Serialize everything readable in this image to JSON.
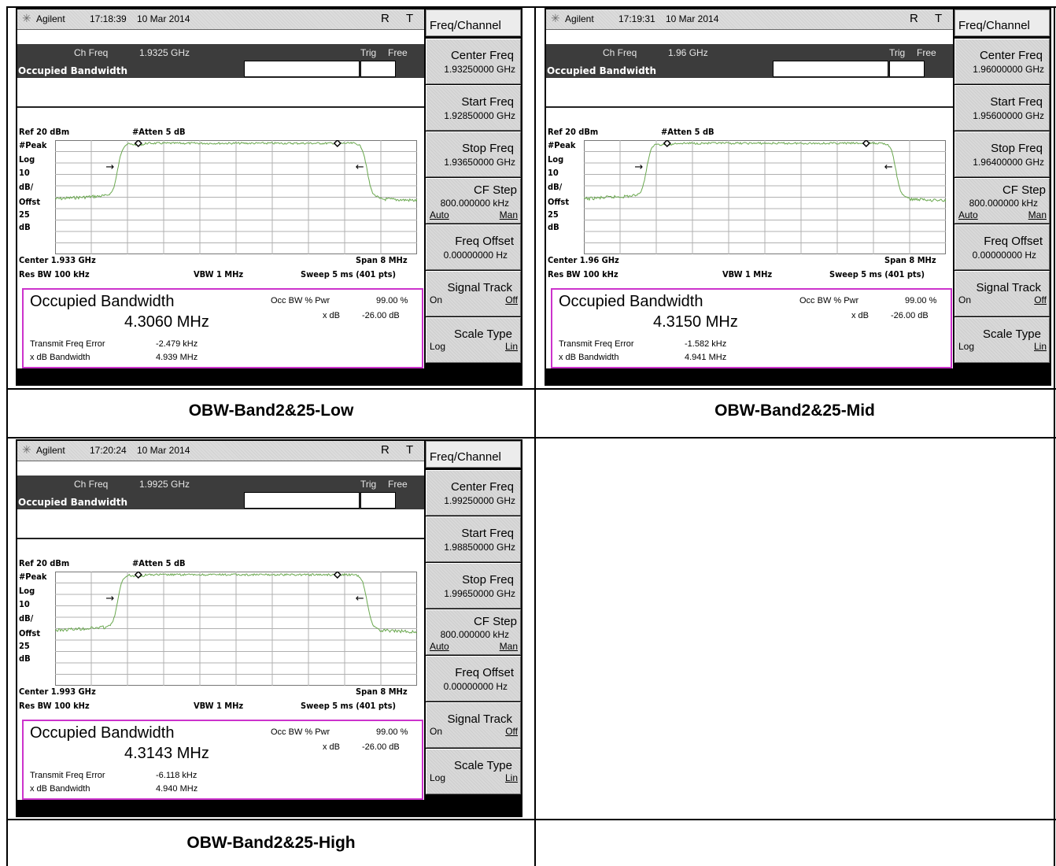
{
  "panels": [
    {
      "instrument": "Agilent",
      "time": "17:18:39",
      "date": "10 Mar 2014",
      "status_r": "R",
      "status_t": "T",
      "ch_freq_label": "Ch Freq",
      "ch_freq": "1.9325 GHz",
      "trig_label": "Trig",
      "trig_value": "Free",
      "meas_name": "Occupied Bandwidth",
      "ref_level": "Ref 20 dBm",
      "atten": "#Atten 5 dB",
      "scale_labels": [
        "#Peak",
        "Log",
        "10",
        "dB/",
        "Offst",
        "25",
        "dB"
      ],
      "center": "Center 1.933 GHz",
      "span": "Span 8 MHz",
      "res_bw": "Res BW 100 kHz",
      "vbw": "VBW 1 MHz",
      "sweep": "Sweep 5 ms (401 pts)",
      "result_title": "Occupied Bandwidth",
      "result_value": "4.3060 MHz",
      "occ_bw_pwr_label": "Occ BW % Pwr",
      "occ_bw_pwr": "99.00 %",
      "xdb_label": "x dB",
      "xdb": "-26.00 dB",
      "tx_freq_err_label": "Transmit Freq Error",
      "tx_freq_err": "-2.479 kHz",
      "xdb_bw_label": "x dB Bandwidth",
      "xdb_bw": "4.939 MHz",
      "menu_title": "Freq/Channel",
      "center_freq_label": "Center Freq",
      "center_freq": "1.93250000 GHz",
      "start_freq_label": "Start Freq",
      "start_freq": "1.92850000 GHz",
      "stop_freq_label": "Stop Freq",
      "stop_freq": "1.93650000 GHz",
      "cf_step_label": "CF Step",
      "cf_step": "800.000000 kHz",
      "cf_auto": "Auto",
      "cf_man": "Man",
      "freq_offset_label": "Freq Offset",
      "freq_offset": "0.00000000  Hz",
      "signal_track_label": "Signal Track",
      "signal_track_on": "On",
      "signal_track_off": "Off",
      "scale_type_label": "Scale Type",
      "scale_type_log": "Log",
      "scale_type_lin": "Lin",
      "caption": "OBW-Band2&25-Low"
    },
    {
      "instrument": "Agilent",
      "time": "17:19:31",
      "date": "10 Mar 2014",
      "status_r": "R",
      "status_t": "T",
      "ch_freq_label": "Ch Freq",
      "ch_freq": "1.96 GHz",
      "trig_label": "Trig",
      "trig_value": "Free",
      "meas_name": "Occupied Bandwidth",
      "ref_level": "Ref 20 dBm",
      "atten": "#Atten 5 dB",
      "scale_labels": [
        "#Peak",
        "Log",
        "10",
        "dB/",
        "Offst",
        "25",
        "dB"
      ],
      "center": "Center 1.96 GHz",
      "span": "Span 8 MHz",
      "res_bw": "Res BW 100 kHz",
      "vbw": "VBW 1 MHz",
      "sweep": "Sweep 5 ms (401 pts)",
      "result_title": "Occupied Bandwidth",
      "result_value": "4.3150 MHz",
      "occ_bw_pwr_label": "Occ BW % Pwr",
      "occ_bw_pwr": "99.00 %",
      "xdb_label": "x dB",
      "xdb": "-26.00 dB",
      "tx_freq_err_label": "Transmit Freq Error",
      "tx_freq_err": "-1.582 kHz",
      "xdb_bw_label": "x dB Bandwidth",
      "xdb_bw": "4.941 MHz",
      "menu_title": "Freq/Channel",
      "center_freq_label": "Center Freq",
      "center_freq": "1.96000000 GHz",
      "start_freq_label": "Start Freq",
      "start_freq": "1.95600000 GHz",
      "stop_freq_label": "Stop Freq",
      "stop_freq": "1.96400000 GHz",
      "cf_step_label": "CF Step",
      "cf_step": "800.000000 kHz",
      "cf_auto": "Auto",
      "cf_man": "Man",
      "freq_offset_label": "Freq Offset",
      "freq_offset": "0.00000000  Hz",
      "signal_track_label": "Signal Track",
      "signal_track_on": "On",
      "signal_track_off": "Off",
      "scale_type_label": "Scale Type",
      "scale_type_log": "Log",
      "scale_type_lin": "Lin",
      "caption": "OBW-Band2&25-Mid"
    },
    {
      "instrument": "Agilent",
      "time": "17:20:24",
      "date": "10 Mar 2014",
      "status_r": "R",
      "status_t": "T",
      "ch_freq_label": "Ch Freq",
      "ch_freq": "1.9925 GHz",
      "trig_label": "Trig",
      "trig_value": "Free",
      "meas_name": "Occupied Bandwidth",
      "ref_level": "Ref 20 dBm",
      "atten": "#Atten 5 dB",
      "scale_labels": [
        "#Peak",
        "Log",
        "10",
        "dB/",
        "Offst",
        "25",
        "dB"
      ],
      "center": "Center 1.993 GHz",
      "span": "Span 8 MHz",
      "res_bw": "Res BW 100 kHz",
      "vbw": "VBW 1 MHz",
      "sweep": "Sweep 5 ms (401 pts)",
      "result_title": "Occupied Bandwidth",
      "result_value": "4.3143 MHz",
      "occ_bw_pwr_label": "Occ BW % Pwr",
      "occ_bw_pwr": "99.00 %",
      "xdb_label": "x dB",
      "xdb": "-26.00 dB",
      "tx_freq_err_label": "Transmit Freq Error",
      "tx_freq_err": "-6.118 kHz",
      "xdb_bw_label": "x dB Bandwidth",
      "xdb_bw": "4.940 MHz",
      "menu_title": "Freq/Channel",
      "center_freq_label": "Center Freq",
      "center_freq": "1.99250000 GHz",
      "start_freq_label": "Start Freq",
      "start_freq": "1.98850000 GHz",
      "stop_freq_label": "Stop Freq",
      "stop_freq": "1.99650000 GHz",
      "cf_step_label": "CF Step",
      "cf_step": "800.000000 kHz",
      "cf_auto": "Auto",
      "cf_man": "Man",
      "freq_offset_label": "Freq Offset",
      "freq_offset": "0.00000000  Hz",
      "signal_track_label": "Signal Track",
      "signal_track_on": "On",
      "signal_track_off": "Off",
      "scale_type_label": "Scale Type",
      "scale_type_log": "Log",
      "scale_type_lin": "Lin",
      "caption": "OBW-Band2&25-High"
    }
  ],
  "colors": {
    "trace": "#6aa84f",
    "graticule": "#b0b0b0",
    "measure_border": "#cc33cc"
  },
  "icons": [
    "agilent-logo-icon",
    "marker-diamond-icon",
    "arrow-right-icon",
    "arrow-left-icon"
  ]
}
